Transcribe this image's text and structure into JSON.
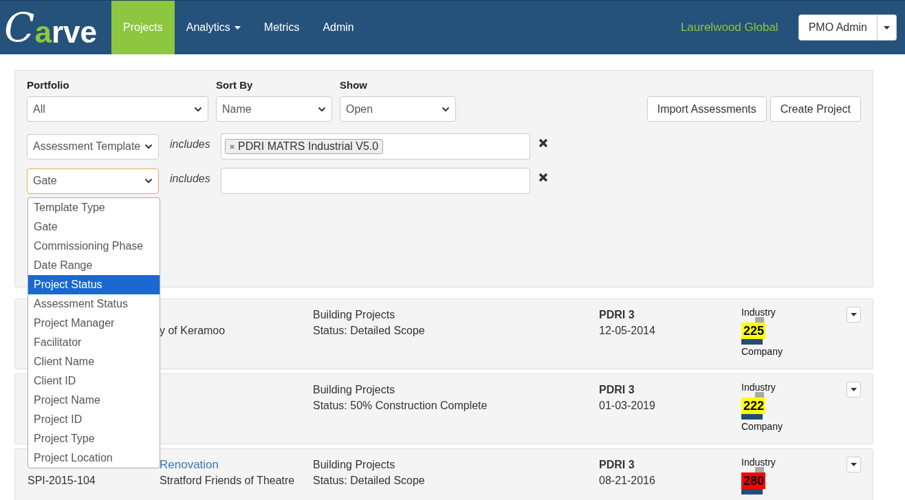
{
  "nav": {
    "logo": [
      {
        "text": "C",
        "kind": "script"
      },
      {
        "text": "a",
        "kind": "accent"
      },
      {
        "text": "rve",
        "kind": "plain"
      }
    ],
    "items": [
      {
        "label": "Projects",
        "selected": true,
        "dropdown": false
      },
      {
        "label": "Analytics",
        "selected": false,
        "dropdown": true
      },
      {
        "label": "Metrics",
        "selected": false,
        "dropdown": false
      },
      {
        "label": "Admin",
        "selected": false,
        "dropdown": false
      }
    ],
    "company": "Laurelwood Global",
    "user_button": "PMO Admin"
  },
  "filters": {
    "selects": [
      {
        "label": "Portfolio",
        "value": "All"
      },
      {
        "label": "Sort By",
        "value": "Name"
      },
      {
        "label": "Show",
        "value": "Open"
      }
    ],
    "buttons": [
      "Import Assessments",
      "Create Project"
    ],
    "criteria": [
      {
        "field": "Assessment Template",
        "operator": "includes",
        "tags": [
          "PDRI MATRS Industrial V5.0"
        ],
        "focused": false
      },
      {
        "field": "Gate",
        "operator": "includes",
        "focused": true
      }
    ],
    "field_menu": [
      {
        "label": "Template Type",
        "selected": false
      },
      {
        "label": "Gate",
        "selected": false
      },
      {
        "label": "Commissioning Phase",
        "selected": false
      },
      {
        "label": "Date Range",
        "selected": false
      },
      {
        "label": "Project Status",
        "selected": true
      },
      {
        "label": "Assessment Status",
        "selected": false
      },
      {
        "label": "Project Manager",
        "selected": false
      },
      {
        "label": "Facilitator",
        "selected": false
      },
      {
        "label": "Client Name",
        "selected": false
      },
      {
        "label": "Client ID",
        "selected": false
      },
      {
        "label": "Project Name",
        "selected": false
      },
      {
        "label": "Project ID",
        "selected": false
      },
      {
        "label": "Project Type",
        "selected": false
      },
      {
        "label": "Project Location",
        "selected": false
      }
    ]
  },
  "projects": [
    {
      "client": "y of Keramoo",
      "category": "Building Projects",
      "status": "Status: Detailed Scope",
      "assessment": "PDRI 3",
      "date": "12-05-2014",
      "industry_label": "Industry",
      "score": "225",
      "color": "#ffff00",
      "company_label": "Company"
    },
    {
      "category": "Building Projects",
      "status": "Status: 50% Construction Complete",
      "assessment": "PDRI 3",
      "date": "01-03-2019",
      "industry_label": "Industry",
      "score": "222",
      "color": "#ffff00",
      "company_label": "Company"
    },
    {
      "id": "SPI-2015-104",
      "name": "Renovation",
      "client": "Stratford Friends of Theatre",
      "category": "Building Projects",
      "status": "Status: Detailed Scope",
      "assessment": "PDRI 3",
      "date": "08-21-2016",
      "industry_label": "Industry",
      "score": "280",
      "color": "#ff0000"
    }
  ]
}
